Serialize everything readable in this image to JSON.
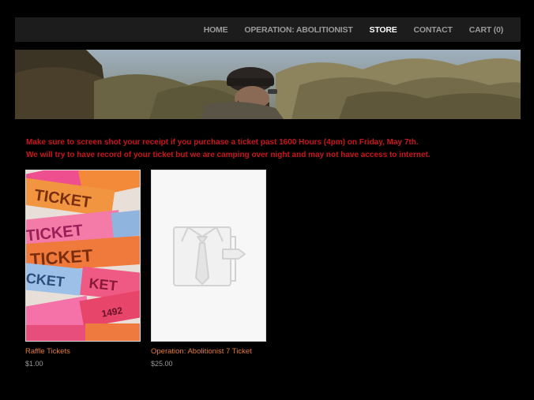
{
  "nav": {
    "items": [
      {
        "label": "HOME",
        "active": false
      },
      {
        "label": "OPERATION: ABOLITIONIST",
        "active": false
      },
      {
        "label": "STORE",
        "active": true
      },
      {
        "label": "CONTACT",
        "active": false
      },
      {
        "label": "CART (0)",
        "active": false
      }
    ]
  },
  "notice": {
    "line1": "Make sure to screen shot your receipt if you purchase a ticket past 1600 Hours (4pm) on Friday, May 7th.",
    "line2": "We will try to have record of your ticket but we are camping over night and may not have access to internet."
  },
  "products": [
    {
      "title": "Raffle Tickets",
      "price": "$1.00",
      "image": "raffle-tickets-photo"
    },
    {
      "title": "Operation: Abolitionist 7 Ticket",
      "price": "$25.00",
      "image": "placeholder-shirt-icon"
    }
  ],
  "colors": {
    "notice": "#c8161d",
    "product_title": "#e47b3b",
    "nav_active": "#ffffff",
    "nav_inactive": "#9a9a9a"
  }
}
